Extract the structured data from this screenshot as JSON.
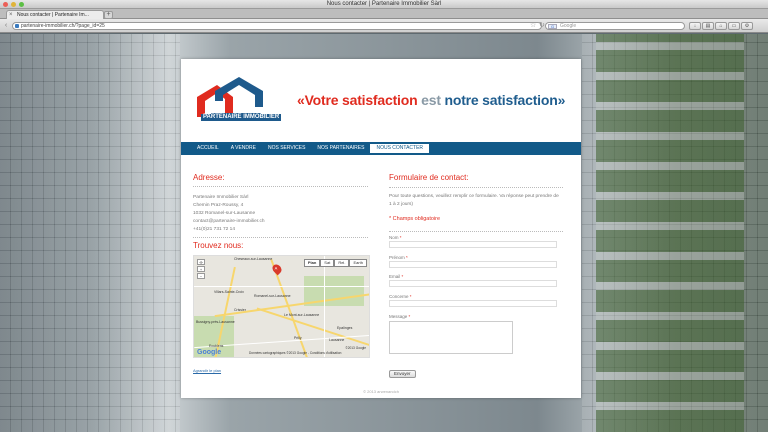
{
  "window": {
    "title": "Nous contacter | Partenaire Immobilier Sàrl"
  },
  "tab": {
    "label": "Nous contacter | Partenaire Im..."
  },
  "browser": {
    "url": "partenaire-immobilier.ch/?page_id=25",
    "search_placeholder": "Google",
    "search_engine_label": "G"
  },
  "site": {
    "logo_text": "PARTENAIRE IMMOBILIER",
    "slogan_open": "«Votre satisfaction",
    "slogan_mid": "est",
    "slogan_close": "notre satisfaction»",
    "colors": {
      "red": "#e02b1f",
      "blue": "#125a89",
      "grey": "#8a9aa6"
    }
  },
  "nav": {
    "items": [
      {
        "label": "ACCUEIL"
      },
      {
        "label": "A VENDRE"
      },
      {
        "label": "NOS SERVICES"
      },
      {
        "label": "NOS PARTENAIRES"
      },
      {
        "label": "NOUS CONTACTER"
      }
    ],
    "active": "NOUS CONTACTER"
  },
  "address": {
    "heading": "Adresse:",
    "lines": [
      "Partenaire Immobilier Sàrl",
      "Chemin Praz-Roussy, 4",
      "1032 Romanel-sur-Lausanne",
      "contact@partenaire-immobilier.ch",
      "+41(0)21 731 72 14"
    ]
  },
  "map": {
    "heading": "Trouvez nous:",
    "types": [
      "Plan",
      "Sat",
      "Rel.",
      "Earth"
    ],
    "selected_type": "Plan",
    "marker": "A",
    "place_labels": [
      "Cheseaux-sur-Lausanne",
      "Romanel-sur-Lausanne",
      "Crissier",
      "Le Mont-sur-Lausanne",
      "Bussigny-près-Lausanne",
      "Epalinges",
      "Lausanne",
      "Ecublens",
      "Prilly",
      "Villars-Sainte-Croix"
    ],
    "footer": "Données cartographiques ©2013 Google - Conditions d'utilisation",
    "copyright": "©2013 Google",
    "google_logo": "Google",
    "enlarge_link": "Agrandir le plan"
  },
  "form": {
    "heading": "Formulaire de contact:",
    "intro": "Pour toute questions, veuillez remplir ce formulaire. Va réponse peut prendre de 1 à 2 jours)",
    "required_note": "* Champs obligatoire",
    "fields": [
      {
        "label": "Nom",
        "value": ""
      },
      {
        "label": "Prénom",
        "value": ""
      },
      {
        "label": "Email",
        "value": ""
      },
      {
        "label": "Concerne",
        "value": ""
      },
      {
        "label": "Message",
        "value": ""
      }
    ],
    "required_marker": "*",
    "submit": "Envoyer"
  },
  "footer": {
    "copyright": "© 2013 arwenandch"
  }
}
